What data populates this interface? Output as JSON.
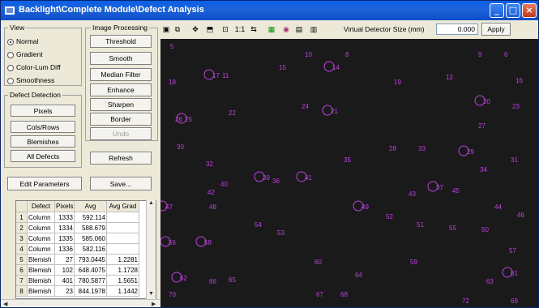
{
  "window": {
    "title": "Backlight\\Complete Module\\Defect Analysis"
  },
  "view": {
    "title": "View",
    "options": [
      {
        "label": "Normal",
        "selected": true
      },
      {
        "label": "Gradient",
        "selected": false
      },
      {
        "label": "Color-Lum Diff",
        "selected": false
      },
      {
        "label": "Smoothness",
        "selected": false
      }
    ]
  },
  "defect_detection": {
    "title": "Defect Detection",
    "buttons": [
      "Pixels",
      "Cols/Rows",
      "Blemishes",
      "All Defects"
    ]
  },
  "image_processing": {
    "title": "Image Processing",
    "buttons": [
      "Threshold",
      "Smooth",
      "Median Filter",
      "Enhance",
      "Sharpen",
      "Border",
      "Undo"
    ],
    "refresh": "Refresh"
  },
  "actions": {
    "edit_parameters": "Edit Parameters",
    "save": "Save..."
  },
  "toolbar": {
    "icons": [
      "save-icon",
      "copy-icon",
      "move-icon",
      "select-icon",
      "fit-icon",
      "ratio-icon",
      "grid-icon",
      "color-icon",
      "settings-icon",
      "histogram-icon",
      "monitor-icon"
    ],
    "zoom_label": "1:1",
    "vds_label": "Virtual Detector Size (mm)",
    "vds_value": "0.000",
    "apply": "Apply"
  },
  "table": {
    "headers": [
      "",
      "Defect",
      "Pixels",
      "Avg",
      "Avg Grad"
    ],
    "rows": [
      {
        "n": "1",
        "defect": "Column",
        "pixels": "1333",
        "avg": "592.114",
        "grad": ""
      },
      {
        "n": "2",
        "defect": "Column",
        "pixels": "1334",
        "avg": "588.679",
        "grad": ""
      },
      {
        "n": "3",
        "defect": "Column",
        "pixels": "1335",
        "avg": "585.060",
        "grad": ""
      },
      {
        "n": "4",
        "defect": "Column",
        "pixels": "1336",
        "avg": "582.116",
        "grad": ""
      },
      {
        "n": "5",
        "defect": "Blemish",
        "pixels": "27",
        "avg": "793.0445",
        "grad": "1.2281"
      },
      {
        "n": "6",
        "defect": "Blemish",
        "pixels": "102",
        "avg": "648.4075",
        "grad": "1.1728"
      },
      {
        "n": "7",
        "defect": "Blemish",
        "pixels": "401",
        "avg": "780.5877",
        "grad": "1.5651"
      },
      {
        "n": "8",
        "defect": "Blemish",
        "pixels": "23",
        "avg": "844.1978",
        "grad": "1.1442"
      }
    ]
  },
  "defect_labels": [
    {
      "id": "5"
    },
    {
      "id": "10"
    },
    {
      "id": "8"
    },
    {
      "id": "15"
    },
    {
      "id": "14"
    },
    {
      "id": "9"
    },
    {
      "id": "6"
    },
    {
      "id": "17"
    },
    {
      "id": "11"
    },
    {
      "id": "18"
    },
    {
      "id": "19"
    },
    {
      "id": "12"
    },
    {
      "id": "16"
    },
    {
      "id": "24"
    },
    {
      "id": "21"
    },
    {
      "id": "22"
    },
    {
      "id": "20"
    },
    {
      "id": "23"
    },
    {
      "id": "26"
    },
    {
      "id": "25"
    },
    {
      "id": "27"
    },
    {
      "id": "30"
    },
    {
      "id": "28"
    },
    {
      "id": "33"
    },
    {
      "id": "29"
    },
    {
      "id": "35"
    },
    {
      "id": "31"
    },
    {
      "id": "32"
    },
    {
      "id": "34"
    },
    {
      "id": "39"
    },
    {
      "id": "36"
    },
    {
      "id": "41"
    },
    {
      "id": "40"
    },
    {
      "id": "42"
    },
    {
      "id": "37"
    },
    {
      "id": "45"
    },
    {
      "id": "47"
    },
    {
      "id": "48"
    },
    {
      "id": "43"
    },
    {
      "id": "44"
    },
    {
      "id": "49"
    },
    {
      "id": "46"
    },
    {
      "id": "54"
    },
    {
      "id": "53"
    },
    {
      "id": "52"
    },
    {
      "id": "51"
    },
    {
      "id": "55"
    },
    {
      "id": "50"
    },
    {
      "id": "56"
    },
    {
      "id": "58"
    },
    {
      "id": "57"
    },
    {
      "id": "60"
    },
    {
      "id": "59"
    },
    {
      "id": "64"
    },
    {
      "id": "61"
    },
    {
      "id": "62"
    },
    {
      "id": "66"
    },
    {
      "id": "65"
    },
    {
      "id": "63"
    },
    {
      "id": "67"
    },
    {
      "id": "68"
    },
    {
      "id": "70"
    },
    {
      "id": "72"
    },
    {
      "id": "69"
    }
  ],
  "colors": {
    "marker": "#c040e0",
    "titlebar": "#0a5ee8"
  }
}
